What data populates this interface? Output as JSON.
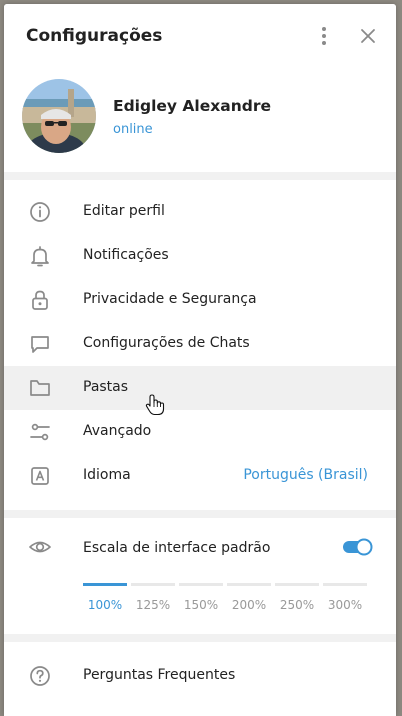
{
  "header": {
    "title": "Configurações"
  },
  "profile": {
    "name": "Edigley Alexandre",
    "status": "online"
  },
  "menu": {
    "items": [
      {
        "label": "Editar perfil",
        "icon": "info-icon"
      },
      {
        "label": "Notificações",
        "icon": "bell-icon"
      },
      {
        "label": "Privacidade e Segurança",
        "icon": "lock-icon"
      },
      {
        "label": "Configurações de Chats",
        "icon": "chat-bubble-icon"
      },
      {
        "label": "Pastas",
        "icon": "folder-icon"
      },
      {
        "label": "Avançado",
        "icon": "sliders-icon"
      },
      {
        "label": "Idioma",
        "icon": "language-icon",
        "value": "Português (Brasil)"
      }
    ]
  },
  "scale": {
    "label": "Escala de interface padrão",
    "enabled": true,
    "options": [
      "100%",
      "125%",
      "150%",
      "200%",
      "250%",
      "300%"
    ],
    "selected": "100%"
  },
  "faq": {
    "label": "Perguntas Frequentes",
    "icon": "question-icon"
  },
  "colors": {
    "accent": "#3a95d6",
    "icon": "#8a8a8a",
    "text": "#222222"
  }
}
